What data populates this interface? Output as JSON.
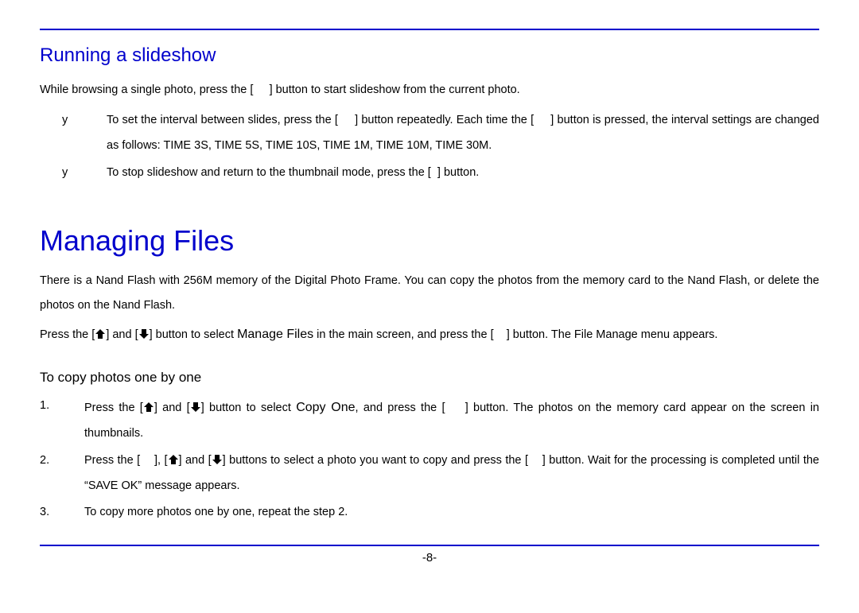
{
  "section1": {
    "title": "Running a slideshow",
    "intro_a": "While browsing a single photo, press the [",
    "intro_b": "] button to start slideshow from the current photo.",
    "bullets": [
      {
        "mark": "y",
        "text_a": "To set the interval between slides, press the [",
        "text_b": "] button repeatedly. Each time the [",
        "text_c": "] button is pressed, the interval settings are changed as follows: TIME 3S, TIME 5S, TIME 10S, TIME 1M, TIME 10M, TIME 30M."
      },
      {
        "mark": "y",
        "text_a": "To stop slideshow and return to the thumbnail mode, press the [",
        "text_b": "] button."
      }
    ]
  },
  "section2": {
    "title": "Managing Files",
    "intro1": "There is a Nand Flash with 256M memory of the Digital Photo Frame. You can copy the photos from the memory card to the Nand Flash, or delete the photos on the Nand Flash.",
    "intro2_a": "Press the [",
    "intro2_b": "] and [",
    "intro2_c": "] button to select ",
    "intro2_manage": "Manage Files",
    "intro2_d": " in the main screen, and press the [",
    "intro2_e": "] button. The File Manage menu appears.",
    "sub": {
      "title": "To copy photos one by one",
      "items": [
        {
          "n": "1.",
          "a": "Press the [",
          "b": "] and [",
          "c": "] button to select ",
          "copy": "Copy One",
          "d": ", and press the [",
          "e": "] button. The photos on the memory card appear on the screen in thumbnails."
        },
        {
          "n": "2.",
          "a": "Press the [",
          "b": "], [",
          "c": "] and [",
          "d": "] buttons to select a photo you want to copy and press the [",
          "e": "] button. Wait for the processing is completed until the “SAVE OK” message appears."
        },
        {
          "n": "3.",
          "a": "To copy more photos one by one, repeat the step 2."
        }
      ]
    }
  },
  "pagenum": "-8-",
  "icons": {
    "up": "⬆",
    "down": "⬇"
  }
}
